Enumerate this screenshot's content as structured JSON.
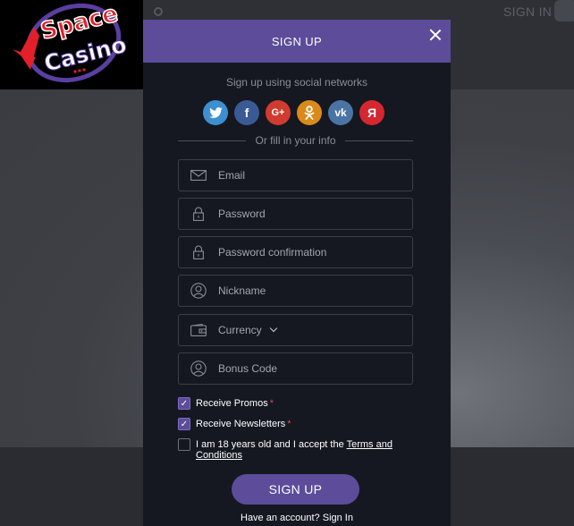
{
  "background": {
    "sign_in": "SIGN IN"
  },
  "logo": {
    "line1": "Space",
    "line2": "Casino",
    "colors": {
      "red": "#e3202a",
      "purple": "#5a3fa0",
      "white": "#ffffff"
    }
  },
  "modal": {
    "title": "SIGN UP",
    "social_label": "Sign up using social networks",
    "social": [
      {
        "name": "twitter",
        "glyph": "",
        "color": "#3c8fd0"
      },
      {
        "name": "facebook",
        "glyph": "f",
        "color": "#3a5a96"
      },
      {
        "name": "google-plus",
        "glyph": "G+",
        "color": "#cf3b2f"
      },
      {
        "name": "odnoklassniki",
        "glyph": "",
        "color": "#d98a1b"
      },
      {
        "name": "vk",
        "glyph": "vk",
        "color": "#4a74a4"
      },
      {
        "name": "yandex",
        "glyph": "Я",
        "color": "#d6262f"
      }
    ],
    "divider_text": "Or fill in your info",
    "fields": {
      "email": "Email",
      "password": "Password",
      "password_confirmation": "Password confirmation",
      "nickname": "Nickname",
      "currency": "Currency",
      "bonus_code": "Bonus Code"
    },
    "checkboxes": {
      "promos": {
        "label": "Receive Promos",
        "checked": true
      },
      "newsletters": {
        "label": "Receive Newsletters",
        "checked": true
      },
      "terms": {
        "prefix": "I am 18 years old and I accept the ",
        "link": "Terms and Conditions",
        "checked": false
      }
    },
    "required_mark": "*",
    "check_glyph": "✓",
    "submit_label": "SIGN UP",
    "account_prompt": "Have an account? ",
    "sign_in_link": "Sign In",
    "colors": {
      "header": "#5c4c99",
      "body": "#151820",
      "field_border": "#3b3e48"
    }
  }
}
